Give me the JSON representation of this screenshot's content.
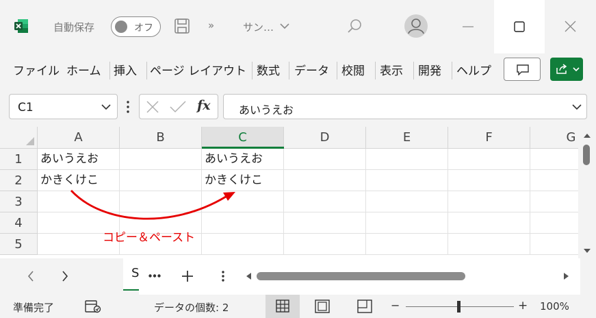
{
  "titlebar": {
    "autosave_label": "自動保存",
    "autosave_toggle": "オフ",
    "more_label": "»",
    "filename": "サン…",
    "colors": {
      "excel_green": "#117e3b"
    }
  },
  "ribbon": {
    "tabs": [
      "ファイル",
      "ホーム",
      "挿入",
      "ページ レイアウト",
      "数式",
      "データ",
      "校閲",
      "表示",
      "開発",
      "ヘルプ"
    ]
  },
  "formula_bar": {
    "name_box": "C1",
    "fx_label": "fx",
    "formula": "あいうえお"
  },
  "grid": {
    "columns": [
      "A",
      "B",
      "C",
      "D",
      "E",
      "F",
      "G"
    ],
    "rows": [
      "1",
      "2",
      "3",
      "4",
      "5"
    ],
    "cells": {
      "A1": "あいうえお",
      "A2": "かきくけこ",
      "C1": "あいうえお",
      "C2": "かきくけこ"
    },
    "selected_cell": "C1"
  },
  "annotation": {
    "text": "コピー＆ペースト",
    "color": "#e60000"
  },
  "sheet_tabs": {
    "active_tab_partial": "S"
  },
  "status_bar": {
    "ready": "準備完了",
    "count_label": "データの個数: 2",
    "zoom_minus": "−",
    "zoom_plus": "+",
    "zoom": "100%"
  }
}
